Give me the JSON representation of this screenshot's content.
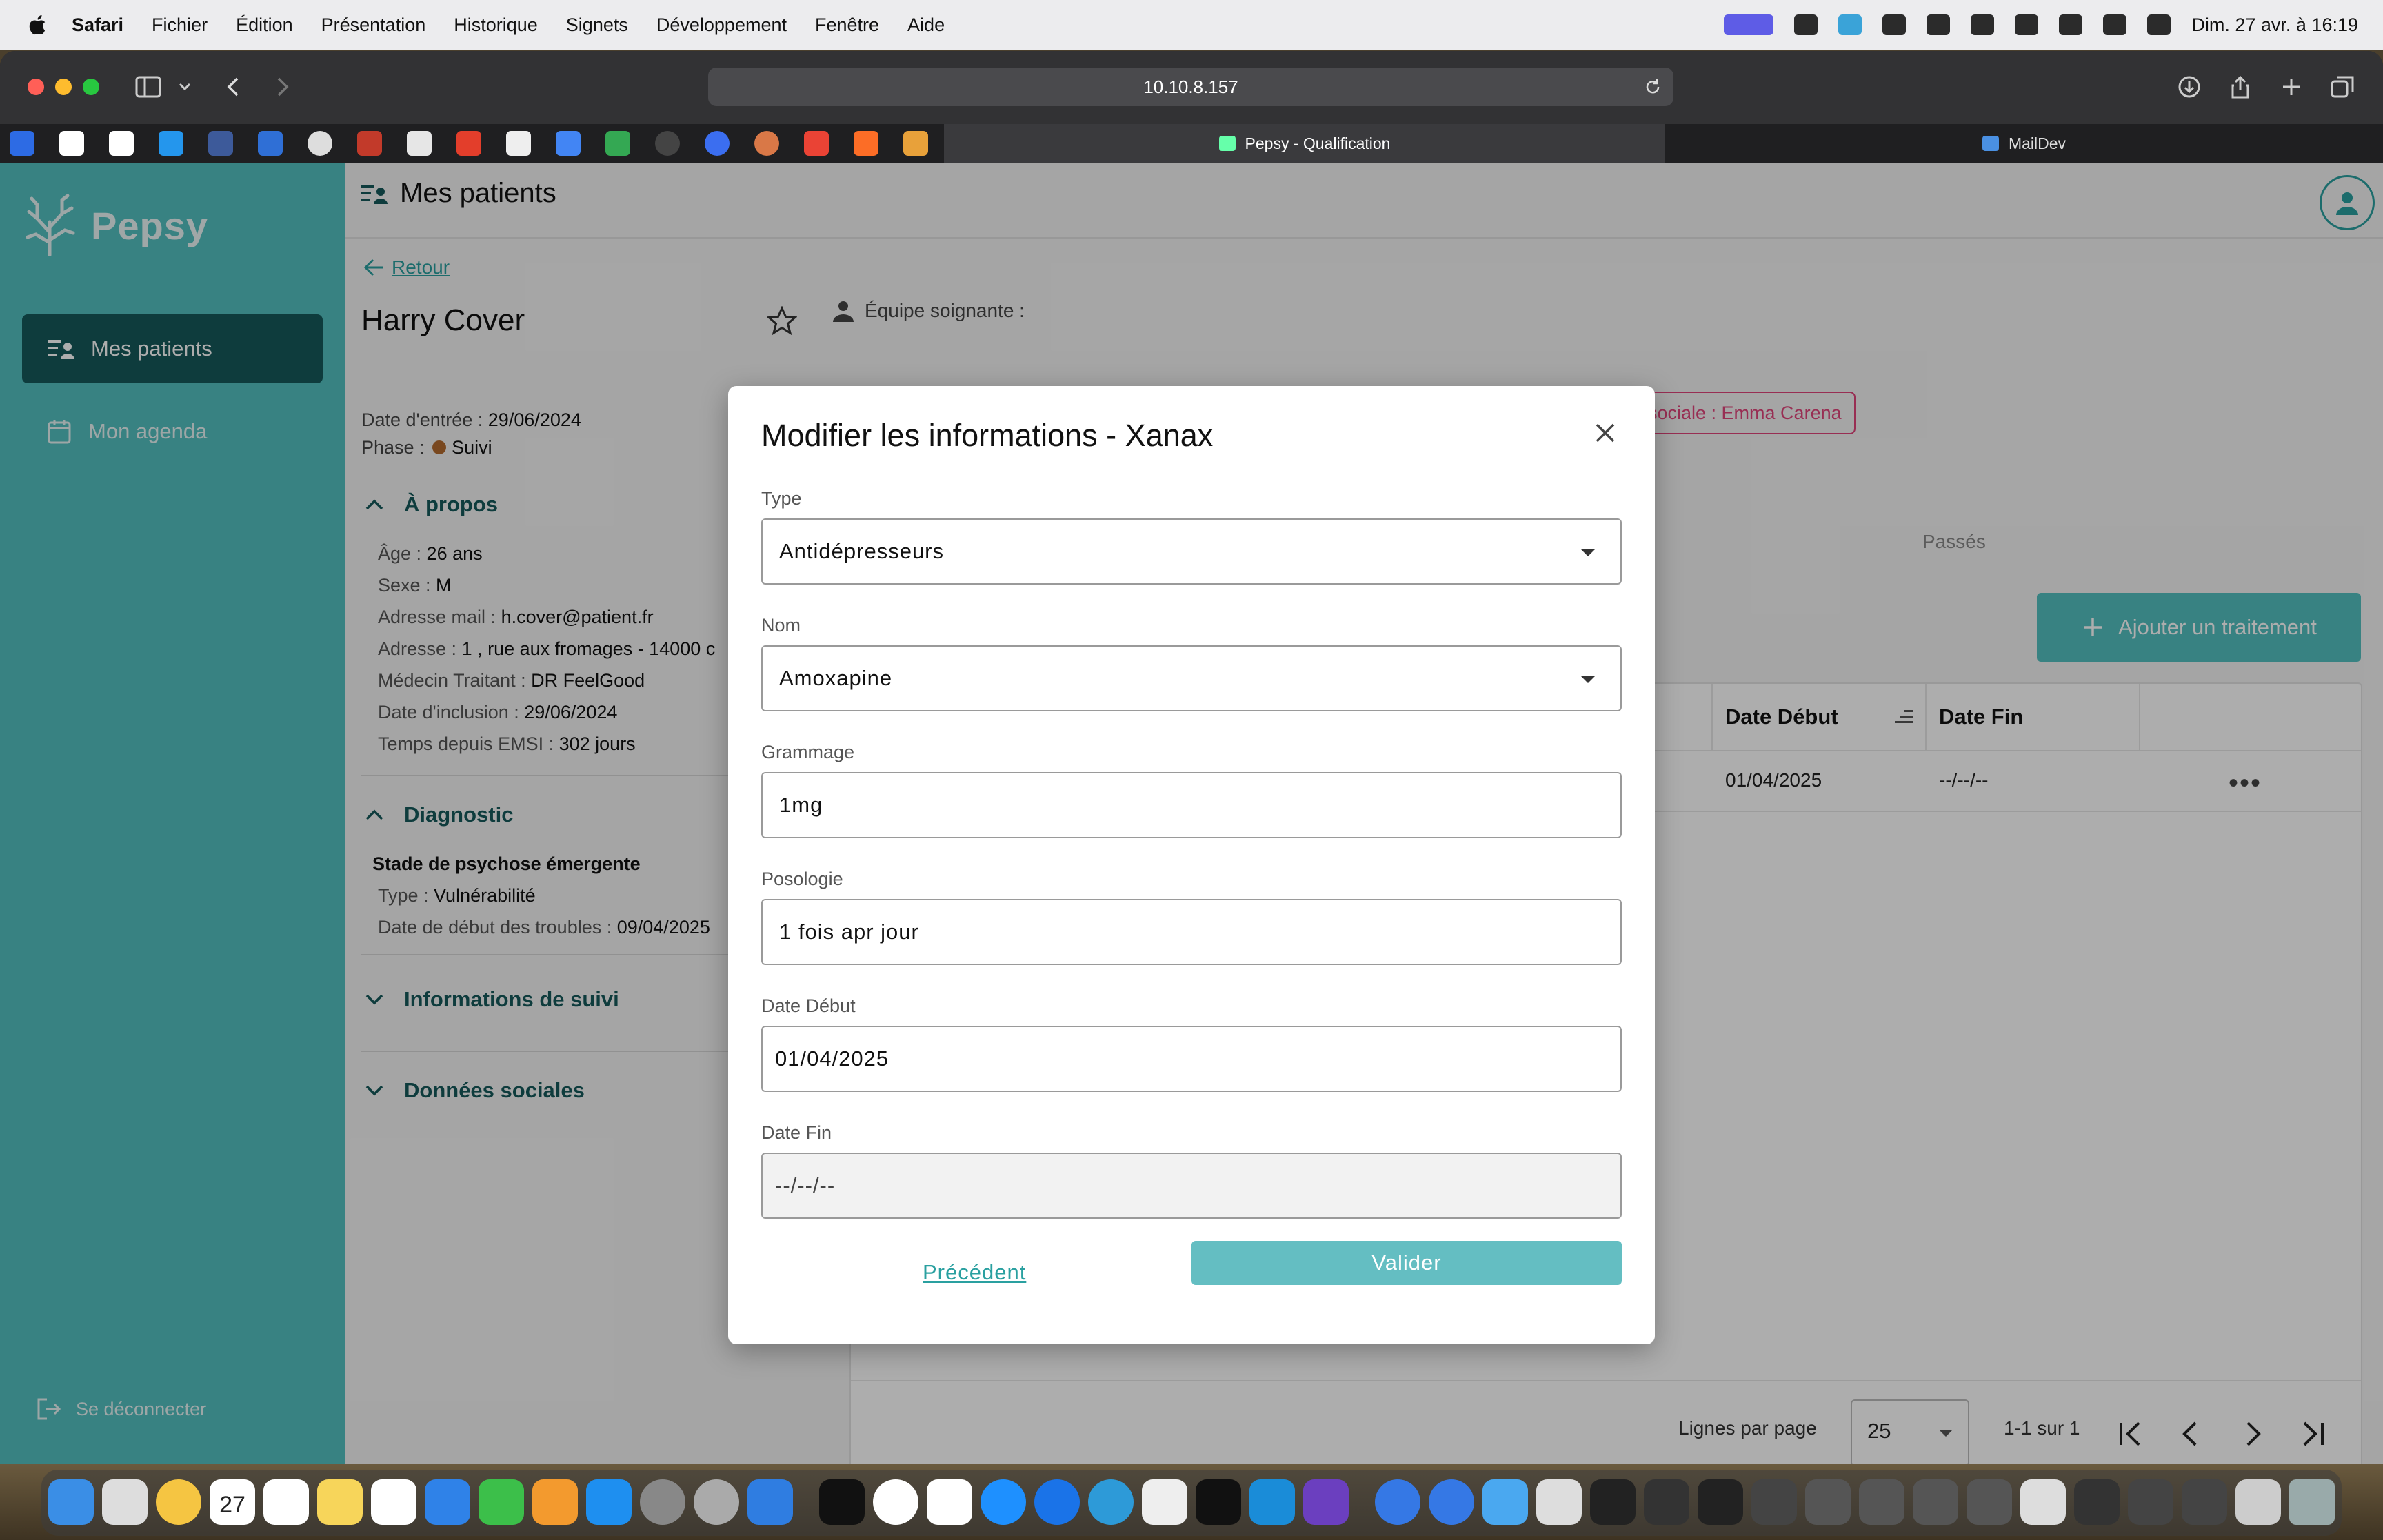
{
  "menubar": {
    "app": "Safari",
    "items": [
      "Fichier",
      "Édition",
      "Présentation",
      "Historique",
      "Signets",
      "Développement",
      "Fenêtre",
      "Aide"
    ],
    "clock": "Dim. 27 avr. à 16:19"
  },
  "browser": {
    "url": "10.10.8.157",
    "tabs": [
      {
        "title": "Pepsy - Qualification"
      },
      {
        "title": "MailDev"
      }
    ]
  },
  "sidebar": {
    "brand": "Pepsy",
    "items": [
      {
        "label": "Mes patients",
        "icon": "patients-list-icon"
      },
      {
        "label": "Mon agenda",
        "icon": "calendar-icon"
      }
    ],
    "logout": "Se déconnecter"
  },
  "page": {
    "title": "Mes patients",
    "back": "Retour"
  },
  "patient": {
    "name": "Harry Cover",
    "entry_label": "Date d'entrée : ",
    "entry_date": "29/06/2024",
    "phase_label": "Phase : ",
    "phase": "Suivi",
    "team_label": "Équipe soignante :",
    "team_tag": "sociale : Emma Carena"
  },
  "about": {
    "title": "À propos",
    "rows": [
      {
        "k": "Âge : ",
        "v": "26 ans"
      },
      {
        "k": "Sexe : ",
        "v": "M"
      },
      {
        "k": "Adresse mail : ",
        "v": "h.cover@patient.fr"
      },
      {
        "k": "Adresse : ",
        "v": "1 , rue aux fromages - 14000 c"
      },
      {
        "k": "Médecin Traitant : ",
        "v": "DR FeelGood"
      },
      {
        "k": "Date d'inclusion : ",
        "v": "29/06/2024"
      },
      {
        "k": "Temps depuis EMSI : ",
        "v": "302 jours"
      }
    ]
  },
  "diagnostic": {
    "title": "Diagnostic",
    "stage": "Stade de psychose émergente",
    "type_label": "Type : ",
    "type": "Vulnérabilité",
    "start_label": "Date de début des troubles : ",
    "start": "09/04/2025"
  },
  "sections": {
    "followup": "Informations de suivi",
    "social": "Données sociales"
  },
  "treatments": {
    "tab_past": "Passés",
    "add_button": "Ajouter un traitement",
    "columns": [
      "Date Début",
      "Date Fin"
    ],
    "rows": [
      {
        "start": "01/04/2025",
        "end": "--/--/--"
      }
    ],
    "pager": {
      "rows_per_page_label": "Lignes par page",
      "rows_per_page": "25",
      "range": "1-1 sur 1"
    }
  },
  "modal": {
    "title": "Modifier les informations - Xanax",
    "fields": {
      "type": {
        "label": "Type",
        "value": "Antidépresseurs"
      },
      "name": {
        "label": "Nom",
        "value": "Amoxapine"
      },
      "dosage": {
        "label": "Grammage",
        "value": "1mg"
      },
      "posology": {
        "label": "Posologie",
        "value": "1 fois apr jour"
      },
      "start": {
        "label": "Date Début",
        "value": "01/04/2025"
      },
      "end": {
        "label": "Date Fin",
        "value": "--/--/--"
      }
    },
    "previous": "Précédent",
    "submit": "Valider"
  },
  "colors": {
    "sidebar": "#53c0c0",
    "sidebar_active": "#15595a",
    "accent": "#2aa0a0",
    "submit": "#64bec2",
    "tag": "#e0457b"
  },
  "dock": {
    "calendar_day": "27"
  }
}
